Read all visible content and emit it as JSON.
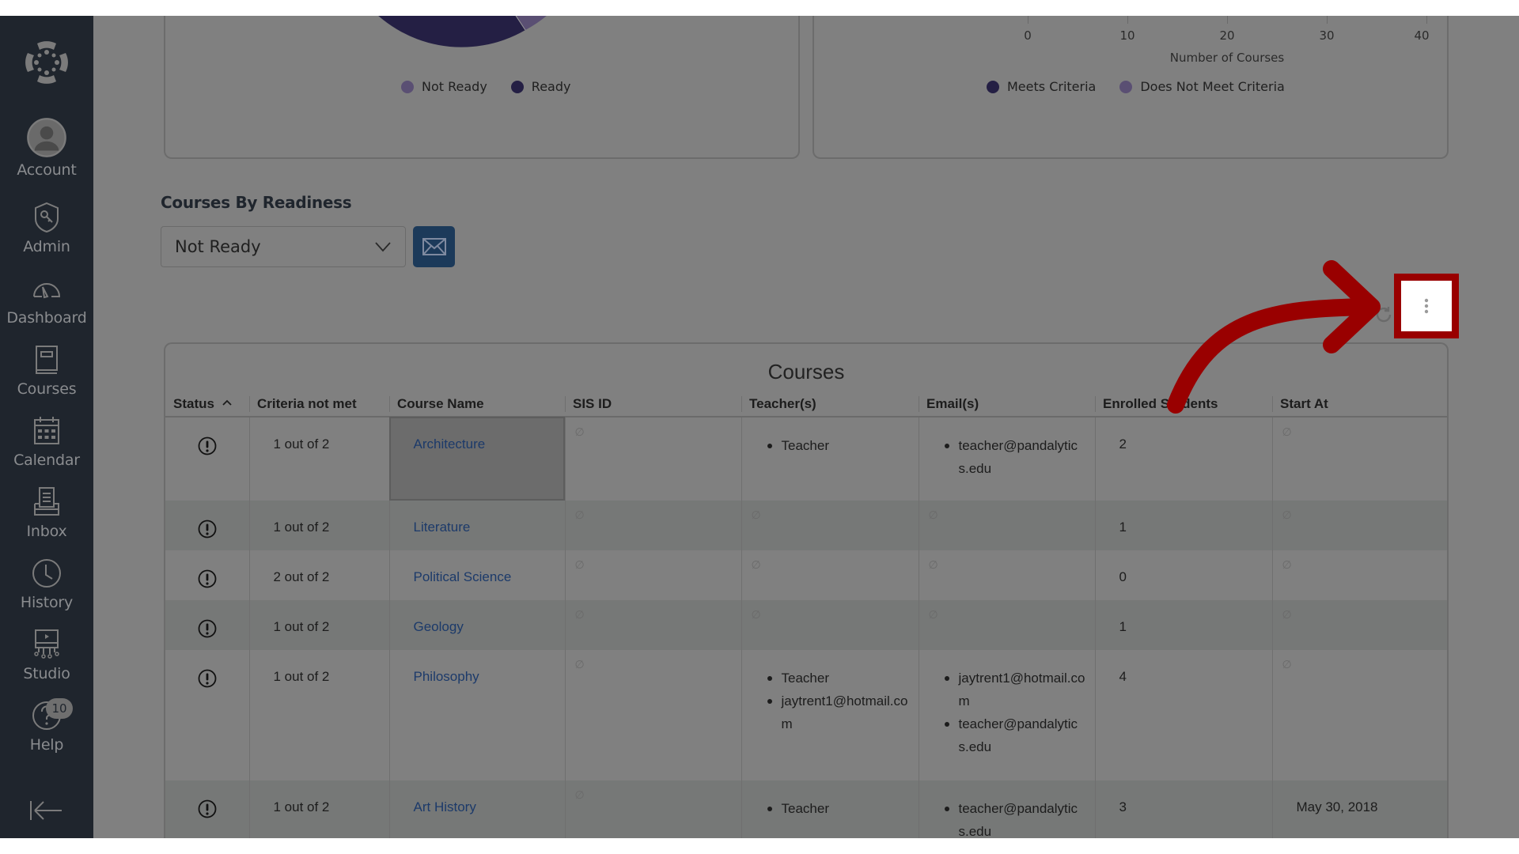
{
  "sidebar": {
    "items": [
      {
        "label": "Account",
        "icon": "account-avatar-icon"
      },
      {
        "label": "Admin",
        "icon": "admin-shield-icon"
      },
      {
        "label": "Dashboard",
        "icon": "dashboard-gauge-icon"
      },
      {
        "label": "Courses",
        "icon": "courses-book-icon"
      },
      {
        "label": "Calendar",
        "icon": "calendar-icon"
      },
      {
        "label": "Inbox",
        "icon": "inbox-icon"
      },
      {
        "label": "History",
        "icon": "history-clock-icon"
      },
      {
        "label": "Studio",
        "icon": "studio-icon"
      },
      {
        "label": "Help",
        "icon": "help-icon",
        "badge": "10"
      }
    ],
    "collapse_icon": "collapse-arrow-icon"
  },
  "charts": {
    "readiness_legend": [
      {
        "label": "Not Ready",
        "color": "#5a4f73"
      },
      {
        "label": "Ready",
        "color": "#241f44"
      }
    ],
    "criteria_legend": [
      {
        "label": "Meets Criteria",
        "color": "#241f44"
      },
      {
        "label": "Does Not Meet Criteria",
        "color": "#5a4f73"
      }
    ],
    "criteria_axis": {
      "ticks": [
        "0",
        "10",
        "20",
        "30",
        "40"
      ],
      "title": "Number of Courses"
    }
  },
  "readiness": {
    "title": "Courses By Readiness",
    "selected": "Not Ready",
    "email_icon": "envelope-icon"
  },
  "table": {
    "title": "Courses",
    "columns": [
      "Status",
      "Criteria not met",
      "Course Name",
      "SIS ID",
      "Teacher(s)",
      "Email(s)",
      "Enrolled Students",
      "Start At"
    ],
    "null_glyph": "∅",
    "rows": [
      {
        "status": "warning",
        "criteria": "1 out of 2",
        "course": "Architecture",
        "sis": null,
        "teachers": [
          "Teacher"
        ],
        "emails": [
          "teacher@pandalytics.edu"
        ],
        "enrolled": "2",
        "start": null
      },
      {
        "status": "warning",
        "criteria": "1 out of 2",
        "course": "Literature",
        "sis": null,
        "teachers": null,
        "emails": null,
        "enrolled": "1",
        "start": null
      },
      {
        "status": "warning",
        "criteria": "2 out of 2",
        "course": "Political Science",
        "sis": null,
        "teachers": null,
        "emails": null,
        "enrolled": "0",
        "start": null
      },
      {
        "status": "warning",
        "criteria": "1 out of 2",
        "course": "Geology",
        "sis": null,
        "teachers": null,
        "emails": null,
        "enrolled": "1",
        "start": null
      },
      {
        "status": "warning",
        "criteria": "1 out of 2",
        "course": "Philosophy",
        "sis": null,
        "teachers": [
          "Teacher",
          "jaytrent1@hotmail.com"
        ],
        "emails": [
          "jaytrent1@hotmail.com",
          "teacher@pandalytics.edu"
        ],
        "enrolled": "4",
        "start": null
      },
      {
        "status": "warning",
        "criteria": "1 out of 2",
        "course": "Art History",
        "sis": null,
        "teachers": [
          "Teacher"
        ],
        "emails": [
          "teacher@pandalytics.edu"
        ],
        "enrolled": "3",
        "start": "May 30, 2018"
      }
    ]
  },
  "toolbar": {
    "refresh_icon": "refresh-icon",
    "menu_icon": "kebab-menu-icon"
  },
  "annotation": {
    "color": "#990000"
  }
}
